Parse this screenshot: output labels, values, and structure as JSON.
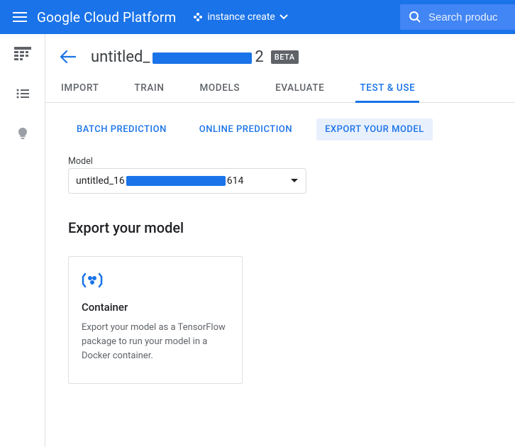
{
  "header": {
    "product_title": "Google Cloud Platform",
    "project_name": "instance create"
  },
  "search": {
    "placeholder": "Search produc"
  },
  "page": {
    "dataset_prefix": "untitled_",
    "dataset_suffix": "2",
    "beta_label": "BETA"
  },
  "tabs": {
    "items": [
      {
        "label": "IMPORT"
      },
      {
        "label": "TRAIN"
      },
      {
        "label": "MODELS"
      },
      {
        "label": "EVALUATE"
      },
      {
        "label": "TEST & USE"
      }
    ],
    "active_index": 4
  },
  "subtabs": {
    "items": [
      {
        "label": "BATCH PREDICTION"
      },
      {
        "label": "ONLINE PREDICTION"
      },
      {
        "label": "EXPORT YOUR MODEL"
      }
    ],
    "active_index": 2
  },
  "model": {
    "label": "Model",
    "value_prefix": "untitled_16",
    "value_suffix": "614"
  },
  "section": {
    "heading": "Export your model"
  },
  "card": {
    "title": "Container",
    "description": "Export your model as a TensorFlow package to run your model in a Docker container."
  }
}
